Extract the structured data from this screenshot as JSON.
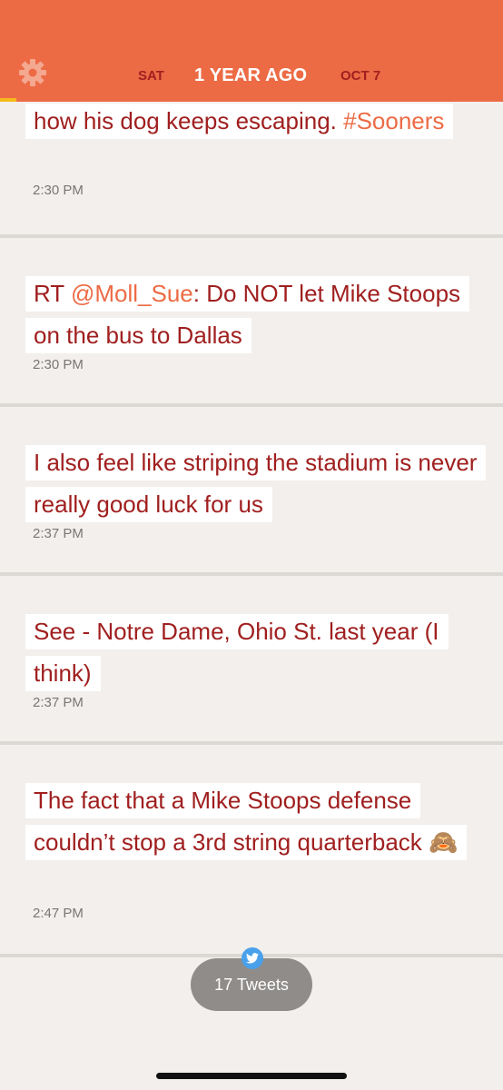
{
  "header": {
    "prev_label": "SAT",
    "title": "1 YEAR AGO",
    "next_label": "OCT 7",
    "settings_icon": "gear-icon",
    "bg_color": "#ec6b45",
    "accent_color": "#f6b91c"
  },
  "tweets": [
    {
      "parts": [
        {
          "text": "how his dog keeps escaping. ",
          "type": "text"
        },
        {
          "text": "#Sooners",
          "type": "hashtag"
        }
      ],
      "time": "2:30 PM"
    },
    {
      "parts": [
        {
          "text": "RT ",
          "type": "text"
        },
        {
          "text": "@Moll_Sue",
          "type": "mention"
        },
        {
          "text": ": Do NOT let Mike Stoops on the bus to Dallas",
          "type": "text"
        }
      ],
      "time": "2:30 PM"
    },
    {
      "parts": [
        {
          "text": "I also feel like striping the stadium is never really good luck for us",
          "type": "text"
        }
      ],
      "time": "2:37 PM"
    },
    {
      "parts": [
        {
          "text": "See - Notre Dame, Ohio St. last year (I think)",
          "type": "text"
        }
      ],
      "time": "2:37 PM"
    },
    {
      "parts": [
        {
          "text": "The fact that a Mike Stoops defense couldn’t stop a 3rd string quarterback 🙈",
          "type": "text"
        }
      ],
      "time": "2:47 PM"
    }
  ],
  "footer": {
    "tweets_count_label": "17 Tweets",
    "badge_icon": "twitter-bird-icon"
  },
  "colors": {
    "text": "#a01f1f",
    "link": "#ec6b45",
    "background": "#f2efec"
  }
}
